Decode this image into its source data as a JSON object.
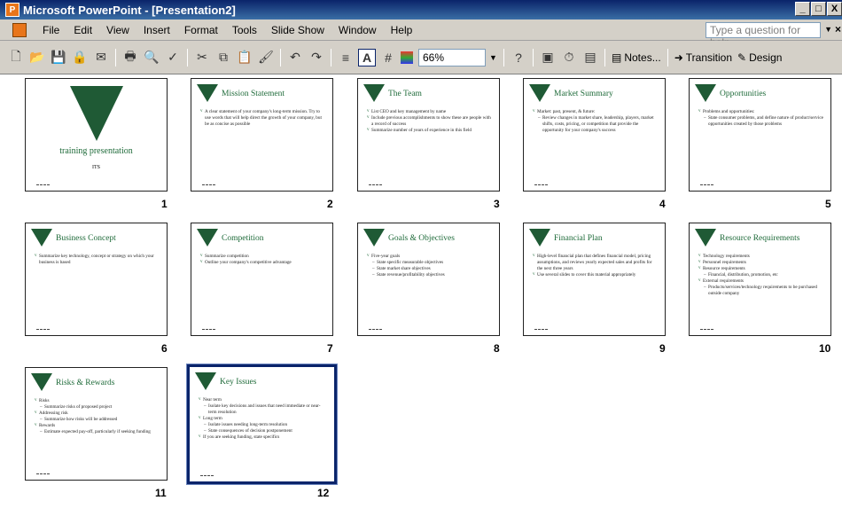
{
  "window": {
    "title": "Microsoft PowerPoint - [Presentation2]",
    "controls": [
      "_",
      "□",
      "X"
    ]
  },
  "menu": {
    "items": [
      "File",
      "Edit",
      "View",
      "Insert",
      "Format",
      "Tools",
      "Slide Show",
      "Window",
      "Help"
    ],
    "ask_placeholder": "Type a question for help"
  },
  "toolbar": {
    "zoom": "66%",
    "notes_label": "Notes...",
    "transition_label": "Transition",
    "design_label": "Design"
  },
  "slides": [
    {
      "num": "1",
      "title": "training presentation",
      "subtitle": "ITS",
      "kind": "title",
      "bullets": []
    },
    {
      "num": "2",
      "title": "Mission Statement",
      "kind": "content",
      "bullets": [
        {
          "lvl": 1,
          "text": "A clear statement of your company's long-term mission. Try to use words that will help direct the growth of your company, but be as concise as possible"
        }
      ]
    },
    {
      "num": "3",
      "title": "The Team",
      "kind": "content",
      "bullets": [
        {
          "lvl": 1,
          "text": "List CEO and key management by name"
        },
        {
          "lvl": 1,
          "text": "Include previous accomplishments to show these are people with a record of success"
        },
        {
          "lvl": 1,
          "text": "Summarize number of years of experience in this field"
        }
      ]
    },
    {
      "num": "4",
      "title": "Market Summary",
      "kind": "content",
      "bullets": [
        {
          "lvl": 1,
          "text": "Market: past, present, & future:"
        },
        {
          "lvl": 2,
          "text": "Review changes in market share, leadership, players, market shifts, costs, pricing, or competition that provide the opportunity for your company's success"
        }
      ]
    },
    {
      "num": "5",
      "title": "Opportunities",
      "kind": "content",
      "bullets": [
        {
          "lvl": 1,
          "text": "Problems and opportunities:"
        },
        {
          "lvl": 2,
          "text": "State consumer problems, and define nature of product/service opportunities created by those problems"
        }
      ]
    },
    {
      "num": "6",
      "title": "Business Concept",
      "kind": "content",
      "bullets": [
        {
          "lvl": 1,
          "text": "Summarize key technology, concept or strategy on which your business is based"
        }
      ]
    },
    {
      "num": "7",
      "title": "Competition",
      "kind": "content",
      "bullets": [
        {
          "lvl": 1,
          "text": "Summarize competition"
        },
        {
          "lvl": 1,
          "text": "Outline your company's competitive advantage"
        }
      ]
    },
    {
      "num": "8",
      "title": "Goals & Objectives",
      "kind": "content",
      "bullets": [
        {
          "lvl": 1,
          "text": "Five-year goals"
        },
        {
          "lvl": 2,
          "text": "State specific measurable objectives"
        },
        {
          "lvl": 2,
          "text": "State market share objectives"
        },
        {
          "lvl": 2,
          "text": "State revenue/profitability objectives"
        }
      ]
    },
    {
      "num": "9",
      "title": "Financial Plan",
      "kind": "content",
      "bullets": [
        {
          "lvl": 1,
          "text": "High-level financial plan that defines financial model, pricing assumptions, and reviews yearly expected sales and profits for the next three years"
        },
        {
          "lvl": 1,
          "text": "Use several slides to cover this material appropriately"
        }
      ]
    },
    {
      "num": "10",
      "title": "Resource Requirements",
      "kind": "content",
      "bullets": [
        {
          "lvl": 1,
          "text": "Technology requirements"
        },
        {
          "lvl": 1,
          "text": "Personnel requirements"
        },
        {
          "lvl": 1,
          "text": "Resource requirements"
        },
        {
          "lvl": 2,
          "text": "Financial, distribution, promotion, etc"
        },
        {
          "lvl": 1,
          "text": "External requirements"
        },
        {
          "lvl": 2,
          "text": "Products/services/technology requirements to be purchased outside company"
        }
      ]
    },
    {
      "num": "11",
      "title": "Risks & Rewards",
      "kind": "content",
      "bullets": [
        {
          "lvl": 1,
          "text": "Risks"
        },
        {
          "lvl": 2,
          "text": "Summarize risks of proposed project"
        },
        {
          "lvl": 1,
          "text": "Addressing risk"
        },
        {
          "lvl": 2,
          "text": "Summarize how risks will be addressed"
        },
        {
          "lvl": 1,
          "text": "Rewards"
        },
        {
          "lvl": 2,
          "text": "Estimate expected pay-off, particularly if seeking funding"
        }
      ]
    },
    {
      "num": "12",
      "title": "Key Issues",
      "kind": "content",
      "selected": true,
      "bullets": [
        {
          "lvl": 1,
          "text": "Near term"
        },
        {
          "lvl": 2,
          "text": "Isolate key decisions and issues that need immediate or near-term resolution"
        },
        {
          "lvl": 1,
          "text": "Long term"
        },
        {
          "lvl": 2,
          "text": "Isolate issues needing long-term resolution"
        },
        {
          "lvl": 2,
          "text": "State consequences of decision postponement"
        },
        {
          "lvl": 1,
          "text": "If you are seeking funding, state specifics"
        }
      ]
    }
  ],
  "colors": {
    "accent_green": "#1f6b3a",
    "selection": "#0a246a",
    "chrome": "#d4d0c8"
  }
}
